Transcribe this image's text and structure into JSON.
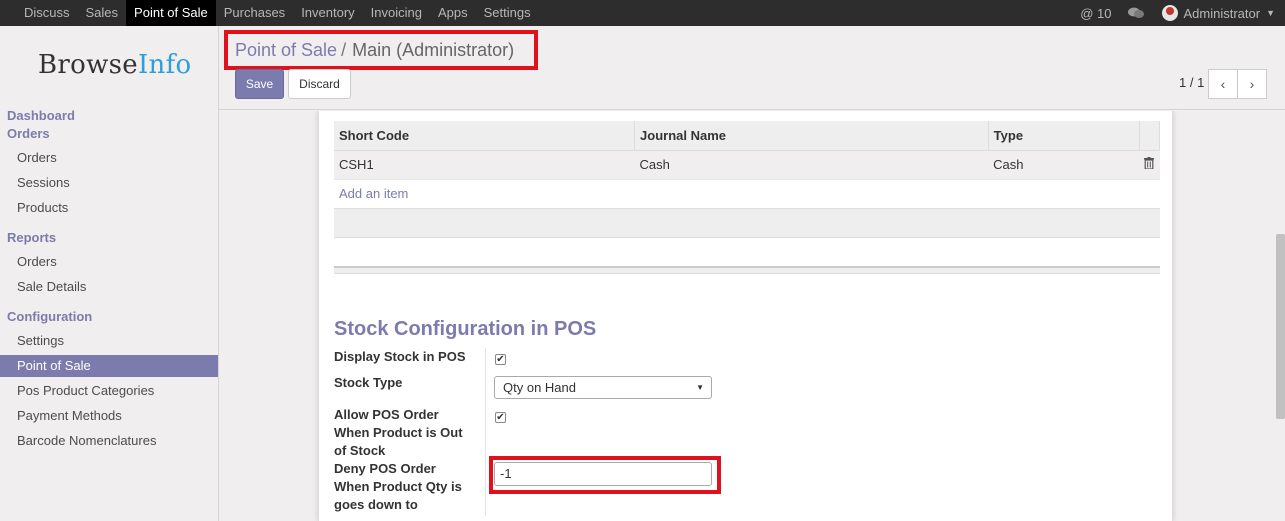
{
  "topnav": {
    "items": [
      "Discuss",
      "Sales",
      "Point of Sale",
      "Purchases",
      "Inventory",
      "Invoicing",
      "Apps",
      "Settings"
    ],
    "active": "Point of Sale",
    "mentions_count": "@ 10",
    "user": "Administrator"
  },
  "sidebar": {
    "logo_left": "Browse",
    "logo_right": "Info",
    "dashboard": "Dashboard",
    "orders_section": "Orders",
    "orders_items": [
      "Orders",
      "Sessions",
      "Products"
    ],
    "reports_section": "Reports",
    "reports_items": [
      "Orders",
      "Sale Details"
    ],
    "configuration_section": "Configuration",
    "configuration_items": [
      "Settings",
      "Point of Sale",
      "Pos Product Categories",
      "Payment Methods",
      "Barcode Nomenclatures"
    ]
  },
  "control": {
    "breadcrumb_link": "Point of Sale",
    "breadcrumb_sep": "/",
    "breadcrumb_current": "Main (Administrator)",
    "save_label": "Save",
    "discard_label": "Discard",
    "pager": "1 / 1"
  },
  "journal_table": {
    "columns": [
      "Short Code",
      "Journal Name",
      "Type"
    ],
    "rows": [
      {
        "short_code": "CSH1",
        "journal_name": "Cash",
        "type": "Cash"
      }
    ],
    "add_item": "Add an item"
  },
  "stock_config": {
    "title": "Stock Configuration in POS",
    "display_stock_label": "Display Stock in POS",
    "display_stock_checked": true,
    "stock_type_label": "Stock Type",
    "stock_type_value": "Qty on Hand",
    "allow_order_label": "Allow POS Order When Product is Out of Stock",
    "allow_order_checked": true,
    "deny_order_label": "Deny POS Order When Product Qty is goes down to",
    "deny_order_value": "-1"
  },
  "colors": {
    "accent": "#7c7bad",
    "highlight": "#e0101d",
    "topbar": "#2d2d2d"
  }
}
